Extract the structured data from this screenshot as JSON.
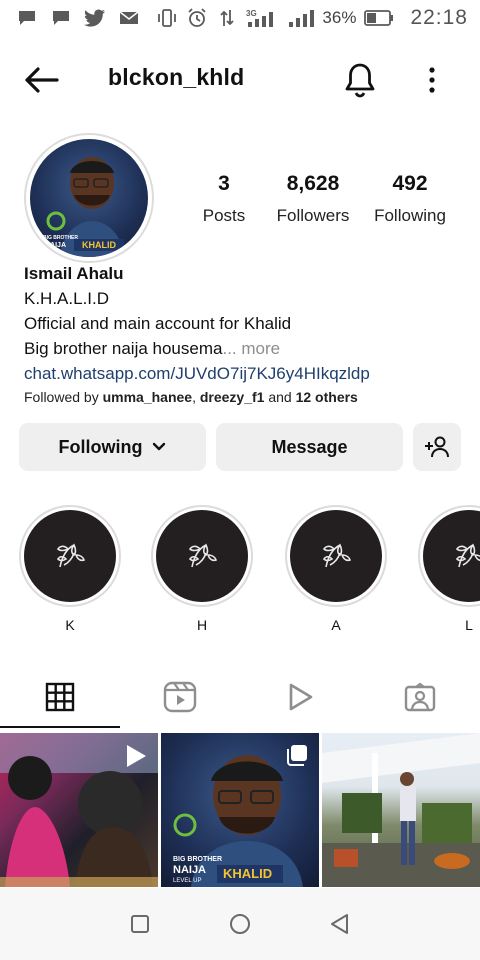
{
  "status_bar": {
    "network_label": "3G",
    "battery": "36%",
    "time": "22:18"
  },
  "header": {
    "username": "blckon_khld"
  },
  "avatar": {
    "tag_text": "KHALID"
  },
  "stats": [
    {
      "value": "3",
      "label": "Posts"
    },
    {
      "value": "8,628",
      "label": "Followers"
    },
    {
      "value": "492",
      "label": "Following"
    }
  ],
  "bio": {
    "name": "Ismail Ahalu",
    "category": "K.H.A.L.I.D",
    "line1": "Official and main account for Khalid",
    "line2": "Big brother naija housema",
    "more": "... more",
    "link": "chat.whatsapp.com/JUVdO7ij7KJ6y4HIkqzldp",
    "followed_prefix": "Followed by ",
    "followed_user1": "umma_hanee",
    "followed_sep": ", ",
    "followed_user2": "dreezy_f1",
    "followed_and": " and ",
    "followed_others": "12 others"
  },
  "buttons": {
    "following": "Following",
    "message": "Message"
  },
  "highlights": [
    {
      "label": "K"
    },
    {
      "label": "H"
    },
    {
      "label": "A"
    },
    {
      "label": "L"
    }
  ],
  "posts": [
    {
      "badge": "reel-icon"
    },
    {
      "badge": "multi-post-icon",
      "tag_text": "KHALID"
    },
    {
      "badge": ""
    }
  ],
  "colors": {
    "link": "#1f3f6e",
    "button_bg": "#efefef",
    "highlight_bg": "#231f20"
  }
}
